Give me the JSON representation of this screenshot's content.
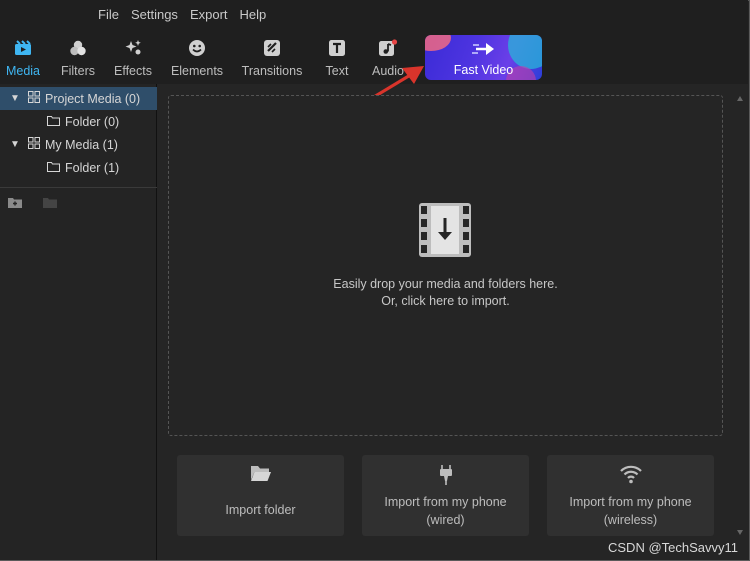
{
  "menu": [
    "File",
    "Settings",
    "Export",
    "Help"
  ],
  "toolbar": {
    "tabs": [
      {
        "label": "Media",
        "icon": "media-icon",
        "active": true
      },
      {
        "label": "Filters",
        "icon": "filters-icon"
      },
      {
        "label": "Effects",
        "icon": "effects-icon"
      },
      {
        "label": "Elements",
        "icon": "elements-icon"
      },
      {
        "label": "Transitions",
        "icon": "transitions-icon"
      },
      {
        "label": "Text",
        "icon": "text-icon"
      },
      {
        "label": "Audio",
        "icon": "audio-icon"
      }
    ],
    "fast_video_label": "Fast Video"
  },
  "tree": {
    "project_media": "Project Media (0)",
    "project_folder": "Folder (0)",
    "my_media": "My Media (1)",
    "my_folder": "Folder (1)"
  },
  "dropzone": {
    "line1": "Easily drop your media and folders here.",
    "line2": "Or, click here to import."
  },
  "import": {
    "folder": "Import folder",
    "wired_line1": "Import from my phone",
    "wired_line2": "(wired)",
    "wireless_line1": "Import from my phone",
    "wireless_line2": "(wireless)"
  },
  "watermark": "CSDN @TechSavvy11",
  "colors": {
    "accent": "#3fb6f2",
    "selected_row": "#2f4e6a",
    "annotation_arrow": "#d9342b"
  }
}
